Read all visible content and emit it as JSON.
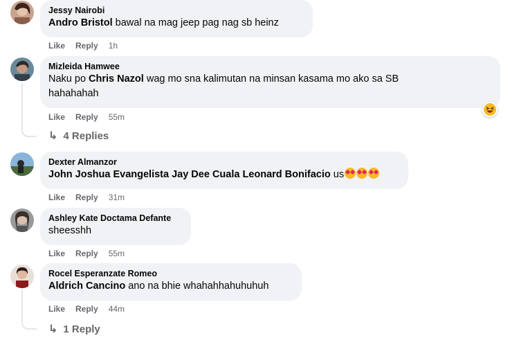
{
  "comments": [
    {
      "author": "Jessy Nairobi",
      "mention": "Andro Bristol",
      "text": " bawal na mag jeep pag nag sb heinz",
      "like": "Like",
      "reply": "Reply",
      "time": "1h"
    },
    {
      "author": "Mizleida Hamwee",
      "text_line1_pre": "Naku po ",
      "mention": "Chris Nazol",
      "text_line1_post": " wag mo sna kalimutan na minsan kasama mo ako sa SB",
      "text_line2": "hahahahah",
      "like": "Like",
      "reply": "Reply",
      "time": "55m",
      "replies_label": "4 Replies",
      "reaction_icon": "laughing-emoji-icon"
    },
    {
      "author": "Dexter Almanzor",
      "mention": "John Joshua Evangelista Jay Dee Cuala Leonard Bonifacio",
      "text": " us",
      "emoji_icon": "heart-eyes-emoji-icon",
      "like": "Like",
      "reply": "Reply",
      "time": "31m"
    },
    {
      "author": "Ashley Kate Doctama Defante",
      "text": "sheesshh",
      "like": "Like",
      "reply": "Reply",
      "time": "55m"
    },
    {
      "author": "Rocel Esperanzate Romeo",
      "mention": "Aldrich Cancino",
      "text": " ano na bhie whahahhahuhuhuh",
      "like": "Like",
      "reply": "Reply",
      "time": "44m",
      "replies_label": "1 Reply"
    }
  ],
  "colors": {
    "bubble": "#f0f2f5",
    "meta": "#65676b",
    "text": "#050505"
  }
}
